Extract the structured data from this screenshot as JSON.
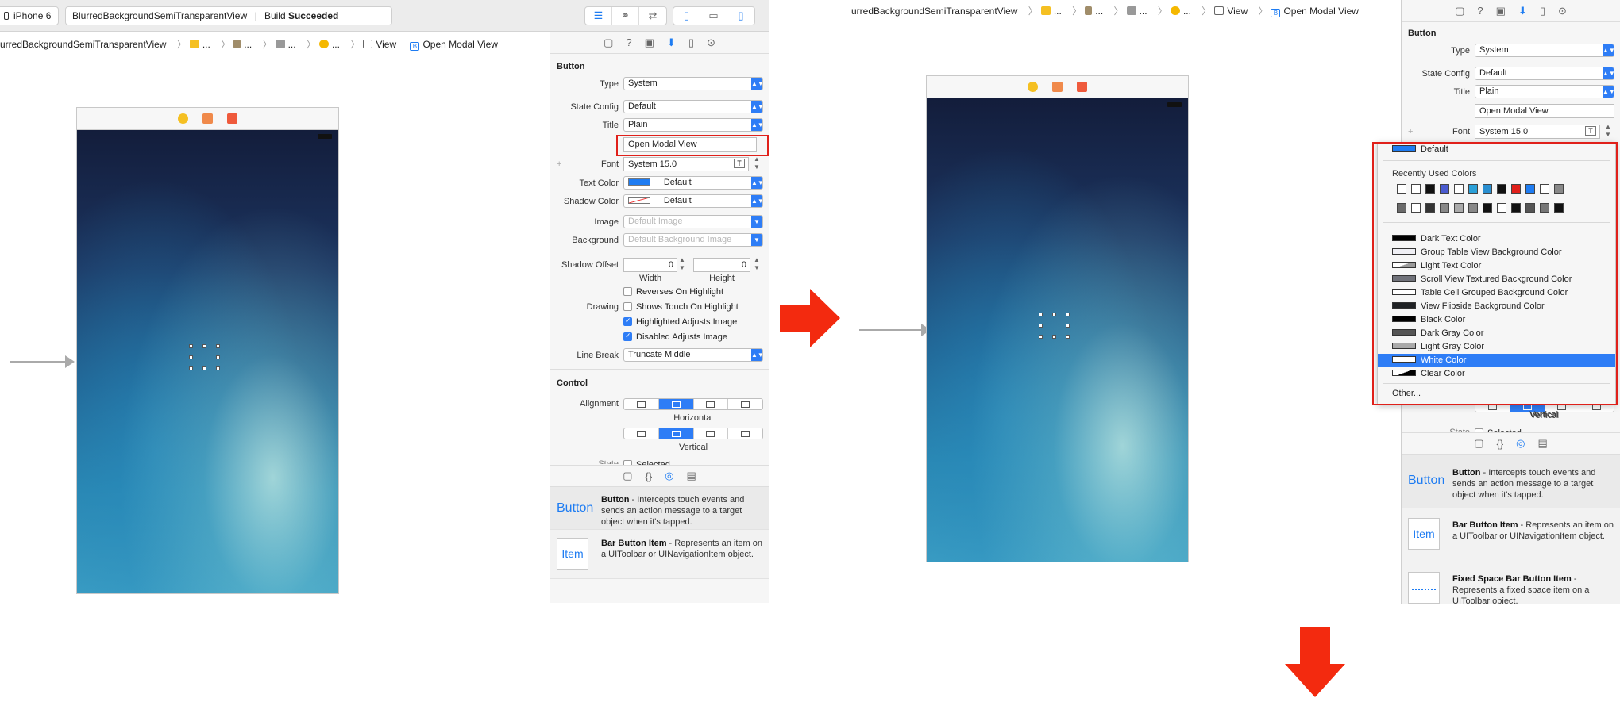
{
  "toolbar": {
    "device": "iPhone 6",
    "project": "BlurredBackgroundSemiTransparentView",
    "build_prefix": "Build",
    "build_status": "Succeeded"
  },
  "left": {
    "breadcrumb": {
      "root": "urredBackgroundSemiTransparentView",
      "items": [
        "...",
        "...",
        "...",
        "...",
        "View",
        "Open Modal View"
      ]
    }
  },
  "right": {
    "breadcrumb": {
      "root": "urredBackgroundSemiTransparentView",
      "items": [
        "...",
        "...",
        "...",
        "...",
        "View",
        "Open Modal View"
      ]
    }
  },
  "inspector": {
    "section_button": "Button",
    "type_label": "Type",
    "type_value": "System",
    "state_label": "State Config",
    "state_value": "Default",
    "title_label": "Title",
    "title_value": "Plain",
    "title_text": "Open Modal View",
    "font_label": "Font",
    "font_value": "System 15.0",
    "plus": "+",
    "text_color_label": "Text Color",
    "text_color_value": "Default",
    "shadow_color_label": "Shadow Color",
    "shadow_color_value": "Default",
    "image_label": "Image",
    "image_placeholder": "Default Image",
    "background_label": "Background",
    "background_placeholder": "Default Background Image",
    "shadow_offset_label": "Shadow Offset",
    "shadow_width_value": "0",
    "shadow_height_value": "0",
    "width_label": "Width",
    "height_label": "Height",
    "drawing_label": "Drawing",
    "reverses_label": "Reverses On Highlight",
    "shows_touch_label": "Shows Touch On Highlight",
    "highlighted_adjusts_label": "Highlighted Adjusts Image",
    "disabled_adjusts_label": "Disabled Adjusts Image",
    "line_break_label": "Line Break",
    "line_break_value": "Truncate Middle",
    "section_control": "Control",
    "alignment_label": "Alignment",
    "horizontal_label": "Horizontal",
    "vertical_label": "Vertical",
    "state_partial": "State",
    "selected_partial": "Selected"
  },
  "library": [
    {
      "icon": "Button",
      "title": "Button",
      "desc": " - Intercepts touch events and sends an action message to a target object when it's tapped."
    },
    {
      "icon": "Item",
      "title": "Bar Button Item",
      "desc": " - Represents an item on a UIToolbar or UINavigationItem object."
    },
    {
      "icon": "",
      "title": "Fixed Space Bar Button Item",
      "desc": " - Represents a fixed space item on a UIToolbar object."
    }
  ],
  "color_menu": {
    "default_label": "Default",
    "recent_header": "Recently Used Colors",
    "recent_row1": [
      "#ffffff",
      "#ffffff",
      "#111111",
      "#4a5bd0",
      "#ffffff",
      "#2aa0d8",
      "#2a8fd0",
      "#111111",
      "#e0201a",
      "#1e7cf2",
      "#ffffff",
      "#888888"
    ],
    "recent_row2": [
      "#6a6a6a",
      "#ffffff",
      "#333333",
      "#888888",
      "#aaaaaa",
      "#888888",
      "#111111",
      "#ffffff",
      "#111111",
      "#555555",
      "#777777",
      "#111111"
    ],
    "named_colors": [
      {
        "label": "Dark Text Color",
        "color": "#000000"
      },
      {
        "label": "Group Table View Background Color",
        "color": "#efeff4"
      },
      {
        "label": "Light Text Color",
        "color": "#999999"
      },
      {
        "label": "Scroll View Textured Background Color",
        "color": "#6f7179"
      },
      {
        "label": "Table Cell Grouped Background Color",
        "color": "#ffffff"
      },
      {
        "label": "View Flipside Background Color",
        "color": "#1f2124"
      },
      {
        "label": "Black Color",
        "color": "#000000"
      },
      {
        "label": "Dark Gray Color",
        "color": "#555555"
      },
      {
        "label": "Light Gray Color",
        "color": "#aaaaaa"
      },
      {
        "label": "White Color",
        "color": "#ffffff"
      },
      {
        "label": "Clear Color",
        "color": "#ffffff"
      }
    ],
    "selected": "White Color",
    "other_label": "Other..."
  },
  "colors": {
    "accent": "#2e7df6",
    "annotation_red": "#e0201a",
    "default_text_color": "#1e7cf2"
  }
}
